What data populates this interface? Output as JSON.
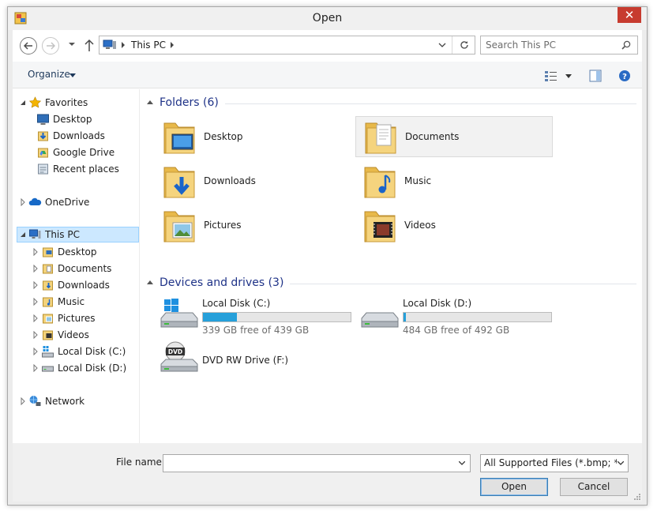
{
  "window": {
    "title": "Open",
    "close_glyph": "✕"
  },
  "nav": {
    "breadcrumb": "This PC",
    "search_placeholder": "Search This PC"
  },
  "toolbar": {
    "organize_label": "Organize"
  },
  "sidebar": {
    "favorites": {
      "label": "Favorites",
      "items": [
        {
          "label": "Desktop",
          "icon": "desktop-icon"
        },
        {
          "label": "Downloads",
          "icon": "downloads-icon"
        },
        {
          "label": "Google Drive",
          "icon": "google-drive-icon"
        },
        {
          "label": "Recent places",
          "icon": "recent-places-icon"
        }
      ]
    },
    "onedrive": {
      "label": "OneDrive"
    },
    "thispc": {
      "label": "This PC",
      "items": [
        {
          "label": "Desktop"
        },
        {
          "label": "Documents"
        },
        {
          "label": "Downloads"
        },
        {
          "label": "Music"
        },
        {
          "label": "Pictures"
        },
        {
          "label": "Videos"
        },
        {
          "label": "Local Disk (C:)"
        },
        {
          "label": "Local Disk (D:)"
        }
      ]
    },
    "network": {
      "label": "Network"
    }
  },
  "content": {
    "folders_header": "Folders (6)",
    "folders": [
      {
        "name": "Desktop",
        "icon": "desktop-folder-icon"
      },
      {
        "name": "Documents",
        "icon": "documents-folder-icon"
      },
      {
        "name": "Downloads",
        "icon": "downloads-folder-icon"
      },
      {
        "name": "Music",
        "icon": "music-folder-icon"
      },
      {
        "name": "Pictures",
        "icon": "pictures-folder-icon"
      },
      {
        "name": "Videos",
        "icon": "videos-folder-icon"
      }
    ],
    "drives_header": "Devices and drives (3)",
    "drives": [
      {
        "name": "Local Disk (C:)",
        "free_text": "339 GB free of 439 GB",
        "used_fraction": 0.228,
        "icon": "windows-drive-icon"
      },
      {
        "name": "Local Disk (D:)",
        "free_text": "484 GB free of 492 GB",
        "used_fraction": 0.016,
        "icon": "hard-drive-icon"
      },
      {
        "name": "DVD RW Drive (F:)",
        "icon": "dvd-drive-icon",
        "badge": "DVD"
      }
    ]
  },
  "footer": {
    "filename_label": "File name:",
    "filename_value": "",
    "filter_value": "All Supported Files (*.bmp; *.dil",
    "open_label": "Open",
    "cancel_label": "Cancel"
  },
  "colors": {
    "accent": "#26a0da",
    "close": "#c73b2f",
    "selection": "#cce8ff",
    "group_header": "#1e3287"
  }
}
